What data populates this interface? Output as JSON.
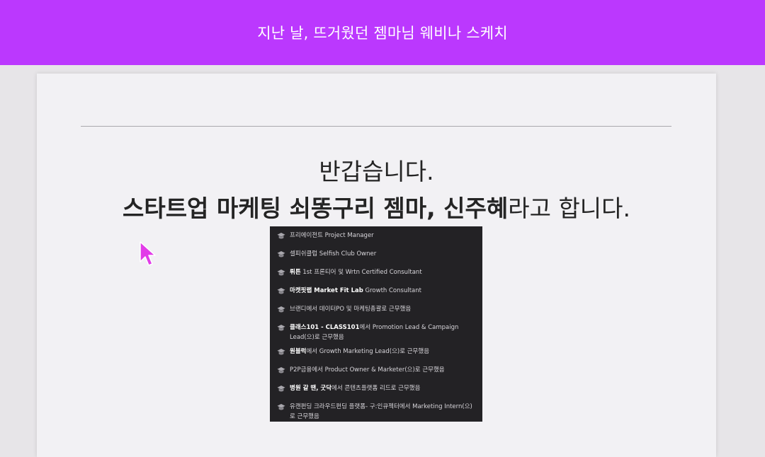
{
  "banner": {
    "title": "지난 날, 뜨거웠던 젬마님 웨비나 스케치"
  },
  "slide": {
    "greeting": "반갑습니다.",
    "intro_bold": "스타트업 마케팅 쇠똥구리 젬마, 신주혜",
    "intro_rest": "라고 합니다.",
    "career_icon": "grad-cap-icon",
    "career_items": [
      {
        "bold": "",
        "text": "프리에이전트 Project Manager"
      },
      {
        "bold": "",
        "text": "셀피쉬클럽 Selfish Club Owner"
      },
      {
        "bold": "뤼튼",
        "text": " 1st 프론티어 및 Wrtn Certified Consultant"
      },
      {
        "bold": "마켓핏랩 Market Fit Lab",
        "text": " Growth Consultant"
      },
      {
        "bold": "",
        "text": "브랜디에서 데이터PO 및 마케팅총괄로 근무했음"
      },
      {
        "bold": "클래스101 - CLASS101",
        "text": "에서 Promotion Lead & Campaign Lead(으)로 근무했음"
      },
      {
        "bold": "원블럭",
        "text": "에서 Growth Marketing Lead(으)로 근무했음"
      },
      {
        "bold": "",
        "text": "P2P금융에서 Product Owner & Marketer(으)로 근무했음"
      },
      {
        "bold": "병원 갈 땐, 굿닥",
        "text": "에서 콘텐츠플랫폼 리드로 근무했음"
      },
      {
        "bold": "",
        "text": "유캔펀딩 크라우드펀딩 플랫폼- 구:인큐젝터에서 Marketing Intern(으)로 근무했음"
      }
    ]
  },
  "cursor": {
    "icon": "mouse-pointer-icon",
    "color": "#e23ce8"
  },
  "colors": {
    "banner": "#bb38fe",
    "slide_bg": "#f2f1f4",
    "career_bg": "#232225"
  }
}
